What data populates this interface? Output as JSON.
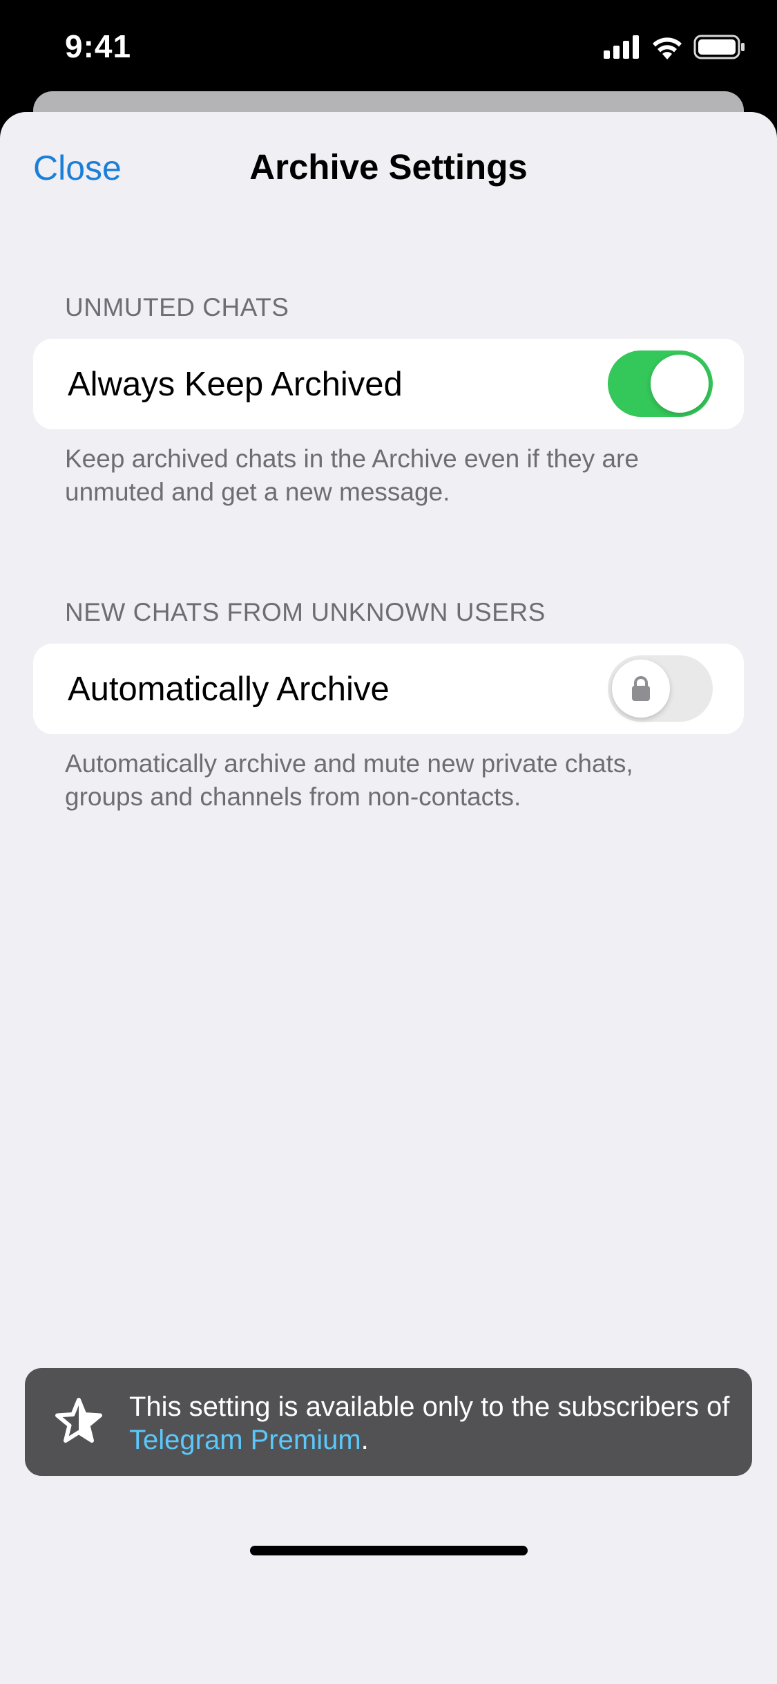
{
  "status_bar": {
    "time": "9:41",
    "icons": [
      "cellular-signal-icon",
      "wifi-icon",
      "battery-icon"
    ]
  },
  "nav": {
    "close_label": "Close",
    "title": "Archive Settings"
  },
  "sections": [
    {
      "header": "UNMUTED CHATS",
      "row_label": "Always Keep Archived",
      "toggle_on": true,
      "footer": "Keep archived chats in the Archive even if they are unmuted and get a new message."
    },
    {
      "header": "NEW CHATS FROM UNKNOWN USERS",
      "row_label": "Automatically Archive",
      "toggle_on": false,
      "locked": true,
      "footer": "Automatically archive and mute new private chats, groups and channels from non-contacts."
    }
  ],
  "toast": {
    "icon": "premium-star-icon",
    "text_before": "This setting is available only to the subscribers of ",
    "link": "Telegram Premium",
    "text_after": "."
  },
  "colors": {
    "accent": "#1a7fd9",
    "toggle_on": "#34c759",
    "link": "#5ac8fa"
  }
}
